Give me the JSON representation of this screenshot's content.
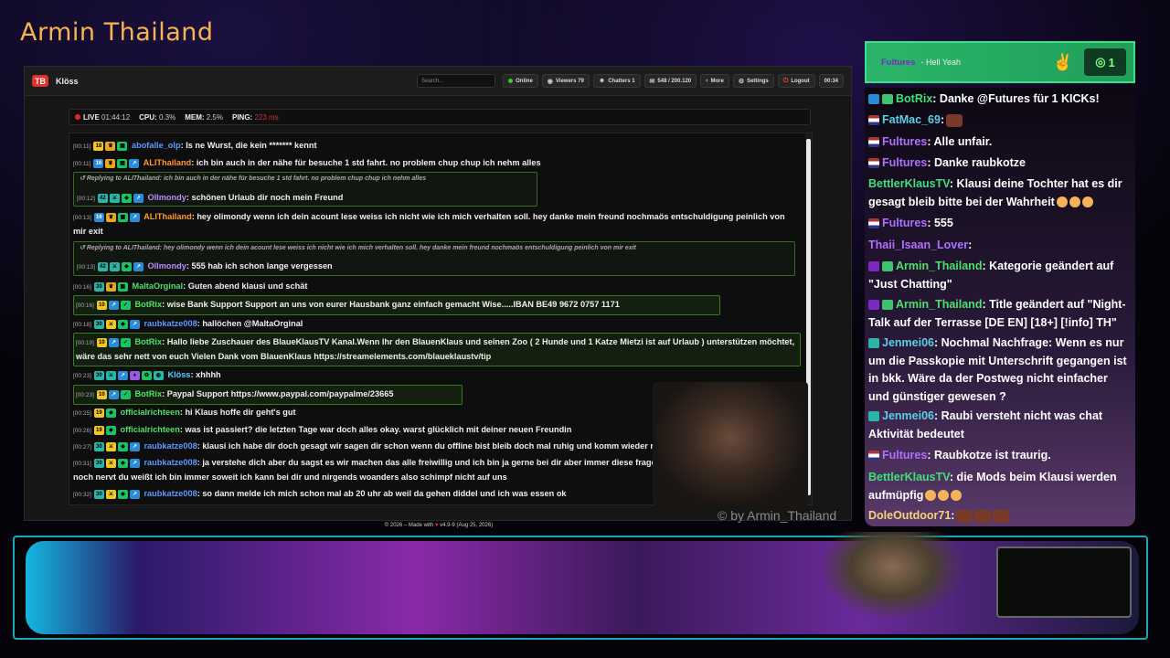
{
  "channel": {
    "title": "Armin Thailand",
    "watermark": "© by Armin_Thailand"
  },
  "app": {
    "title": "Klöss",
    "search_placeholder": "Search...",
    "buttons": {
      "online": "Online",
      "viewers": "Viewers 79",
      "chatters": "Chatters 1",
      "followers": "548 / 200.120",
      "more": "More",
      "settings": "Settings",
      "logout": "Logout",
      "timer": "00:34"
    },
    "status": {
      "live": "LIVE",
      "uptime": "01:44:12",
      "cpu_label": "CPU:",
      "cpu": "0.3%",
      "mem_label": "MEM:",
      "mem": "2.5%",
      "ping_label": "PING:",
      "ping": "223 ms"
    },
    "footer": {
      "prefix": "© 2026 – Made with",
      "suffix": "v4.9-9 (Aug 25, 2026)"
    }
  },
  "messages": [
    {
      "ts": "[00:11]",
      "user": "abofalle_olp",
      "text": "Is ne Wurst, die kein ******* kennt"
    },
    {
      "ts": "[00:11]",
      "user": "ALIThailand",
      "text": "ich bin auch in der nähe für besuche 1 std fahrt. no problem chup chup ich nehm alles"
    },
    {
      "reply": "Replying to ALIThailand: ich bin auch in der nähe für besuche 1 std fahrt. no problem chup chup ich nehm alles"
    },
    {
      "ts": "[00:12]",
      "user": "Ollmondy",
      "text": "schönen Urlaub dir noch mein Freund"
    },
    {
      "ts": "[00:13]",
      "user": "ALIThailand",
      "text": "hey olimondy wenn ich dein acount lese weiss ich nicht wie ich mich verhalten soll. hey danke mein freund nochmaös entschuldigung peinlich von mir exit"
    },
    {
      "reply": "Replying to ALIThailand: hey olimondy wenn ich dein acount lese weiss ich nicht wie ich mich verhalten soll. hey danke mein freund nochmaös entschuldigung peinlich von mir exit"
    },
    {
      "ts": "[00:13]",
      "user": "Ollmondy",
      "text": "555 hab ich schon lange vergessen"
    },
    {
      "ts": "[00:16]",
      "user": "MaltaOrginal",
      "text": "Guten abend klausi und schät"
    },
    {
      "ts": "[00:16]",
      "user": "BotRix",
      "text": "wise Bank Support Support an uns von eurer Hausbank ganz einfach gemacht Wise.....IBAN BE49 9672 0757 1171"
    },
    {
      "ts": "[00:18]",
      "user": "raubkatze008",
      "text": "hallöchen @MaltaOrginal"
    },
    {
      "ts": "[00:19]",
      "user": "BotRix",
      "text": "Hallo liebe Zuschauer des BlaueKlausTV Kanal.Wenn Ihr den BlauenKlaus und seinen Zoo ( 2 Hunde und 1 Katze Mietzi ist auf Urlaub ) unterstützen möchtet, wäre das sehr nett von euch Vielen Dank vom BlauenKlaus https://streamelements.com/blaueklaustv/tip"
    },
    {
      "ts": "[00:23]",
      "user": "Klöss",
      "text": "xhhhh"
    },
    {
      "ts": "[00:23]",
      "user": "BotRix",
      "text": "Paypal Support https://www.paypal.com/paypalme/23665"
    },
    {
      "ts": "[00:25]",
      "user": "officialrichteen",
      "text": "hi Klaus hoffe dir geht's gut"
    },
    {
      "ts": "[00:26]",
      "user": "officialrichteen",
      "text": "was ist passiert? die letzten Tage war doch alles okay. warst glücklich mit deiner neuen Freundin"
    },
    {
      "ts": "[00:27]",
      "user": "raubkatze008",
      "text": "klausi ich habe dir doch gesagt wir sagen dir schon wenn du offline bist bleib doch mal ruhig und komm wieder runter"
    },
    {
      "ts": "[00:31]",
      "user": "raubkatze008",
      "text": "ja verstehe dich aber du sagst es wir machen das alle freiwillig und ich bin ja gerne bei dir aber immer diese fragerei bin ich online oder hört ihr mich noch nervt du weißt ich bin immer soweit ich kann bei dir und nirgends woanders also schimpf nicht auf uns"
    },
    {
      "ts": "[00:32]",
      "user": "raubkatze008",
      "text": "so dann melde ich mich schon mal ab 20 uhr ab weil da gehen diddel und ich was essen ok"
    }
  ],
  "alert": {
    "name": "Fultures",
    "message": "- Hell Yeah",
    "count": "1"
  },
  "sidechat": [
    {
      "user": "BotRix",
      "text": ": Danke @Futures für 1 KICKs!"
    },
    {
      "user": "FatMac_69",
      "text": ":"
    },
    {
      "user": "Fultures",
      "text": ": Alle unfair."
    },
    {
      "user": "Fultures",
      "text": ": Danke raubkotze"
    },
    {
      "user": "BettlerKlausTV",
      "text": ": Klausi deine Tochter hat es dir gesagt bleib bitte bei der Wahrheit"
    },
    {
      "user": "Fultures",
      "text": ": 555"
    },
    {
      "user": "Thaii_Isaan_Lover",
      "text": ":"
    },
    {
      "user": "Armin_Thailand",
      "text": ": Kategorie geändert auf \"Just Chatting\""
    },
    {
      "user": "Armin_Thailand",
      "text": ": Title geändert auf \"Night-Talk auf der Terrasse [DE EN] [18+] [!info] TH\""
    },
    {
      "user": "Jenmei06",
      "text": ": Nochmal Nachfrage: Wenn es nur um die Passkopie mit Unterschrift gegangen ist in bkk. Wäre da der Postweg nicht einfacher und günstiger gewesen ?"
    },
    {
      "user": "Jenmei06",
      "text": ": Raubi versteht nicht was chat Aktivität bedeutet"
    },
    {
      "user": "Fultures",
      "text": ": Raubkotze ist traurig."
    },
    {
      "user": "BettlerKlausTV",
      "text": ": die Mods beim Klausi werden aufmüpfig"
    },
    {
      "user": "DoleOutdoor71",
      "text": ":"
    }
  ],
  "colors": {
    "accent": "#f5b451",
    "alert_bg": "#2bb56a",
    "frame": "#1aa7b8"
  }
}
